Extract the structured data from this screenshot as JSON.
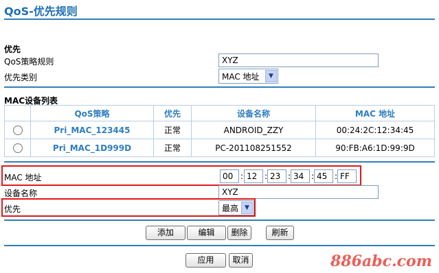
{
  "title": "QoS-优先规则",
  "priority_section": {
    "heading": "优先",
    "rule_label": "QoS策略规则",
    "rule_value": "XYZ",
    "category_label": "优先类别",
    "category_value": "MAC 地址"
  },
  "mac_list": {
    "heading": "MAC设备列表",
    "columns": [
      "QoS策略",
      "优先",
      "设备名称",
      "MAC 地址"
    ],
    "rows": [
      {
        "policy": "Pri_MAC_123445",
        "priority": "正常",
        "device": "ANDROID_ZZY",
        "mac": "00:24:2C:12:34:45"
      },
      {
        "policy": "Pri_MAC_1D999D",
        "priority": "正常",
        "device": "PC-201108251552",
        "mac": "90:FB:A6:1D:99:9D"
      }
    ]
  },
  "form": {
    "mac_label": "MAC 地址",
    "mac_octets": [
      "00",
      "12",
      "23",
      "34",
      "45",
      "FF"
    ],
    "device_label": "设备名称",
    "device_value": "XYZ",
    "priority_label": "优先",
    "priority_value": "最高"
  },
  "buttons": {
    "add": "添加",
    "edit": "编辑",
    "delete": "删除",
    "refresh": "刷新",
    "apply": "应用",
    "cancel": "取消"
  },
  "watermark": "886abc.com",
  "colors": {
    "accent": "#2e7ec1",
    "highlight": "#e01818"
  }
}
